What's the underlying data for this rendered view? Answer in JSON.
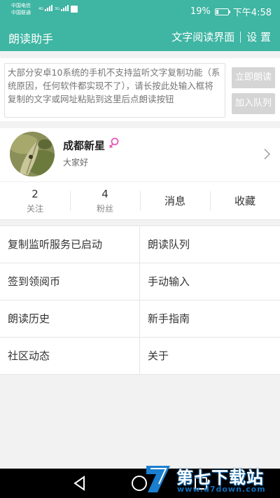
{
  "status_bar": {
    "carrier1": "中国电信",
    "carrier2": "中国联通",
    "sig1_label": "4G",
    "sig2_label": "3G",
    "battery_percent": "19%",
    "battery_level": 0.19,
    "time": "下午4:58"
  },
  "app_bar": {
    "title": "朗读助手",
    "text_reader_label": "文字阅读界面",
    "settings_label": "设 置",
    "color": "#3fb5a3"
  },
  "input_card": {
    "placeholder": "大部分安卓10系统的手机不支持监听文字复制功能（系统原因，任何软件都实现不了），请长按此处输入框将复制的文字或网址粘贴到这里后点朗读按钮",
    "read_now_label": "立即朗读",
    "add_queue_label": "加入队列"
  },
  "profile": {
    "username": "成都新星",
    "gender_icon": "female-icon",
    "bio": "大家好"
  },
  "stats": {
    "following_count": "2",
    "following_label": "关注",
    "fans_count": "4",
    "fans_label": "粉丝",
    "messages_label": "消息",
    "favorites_label": "收藏"
  },
  "menu": [
    "复制监听服务已启动",
    "朗读队列",
    "签到领阅币",
    "手动输入",
    "朗读历史",
    "新手指南",
    "社区动态",
    "关于"
  ],
  "watermark": {
    "text": "第七下载站",
    "url": "www.d7down.com"
  }
}
